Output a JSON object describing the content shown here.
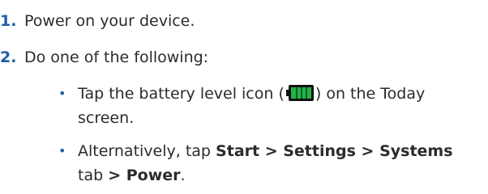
{
  "steps": [
    {
      "number": "1.",
      "text": "Power on your device."
    },
    {
      "number": "2.",
      "text": "Do one of the following:"
    }
  ],
  "bullets": {
    "b1": {
      "text_before": "Tap the battery level icon (",
      "text_after": ") on the Today screen.",
      "icon": "battery-full-icon",
      "level": 1.0,
      "icon_color": "#22b14c"
    },
    "b2": {
      "text_before": "Alternatively, tap ",
      "bold1": "Start > Settings > Systems",
      "mid": " tab ",
      "bold2": "> Power",
      "end": "."
    }
  },
  "colors": {
    "accent": "#1e5fa3",
    "text": "#2b2b2b"
  }
}
